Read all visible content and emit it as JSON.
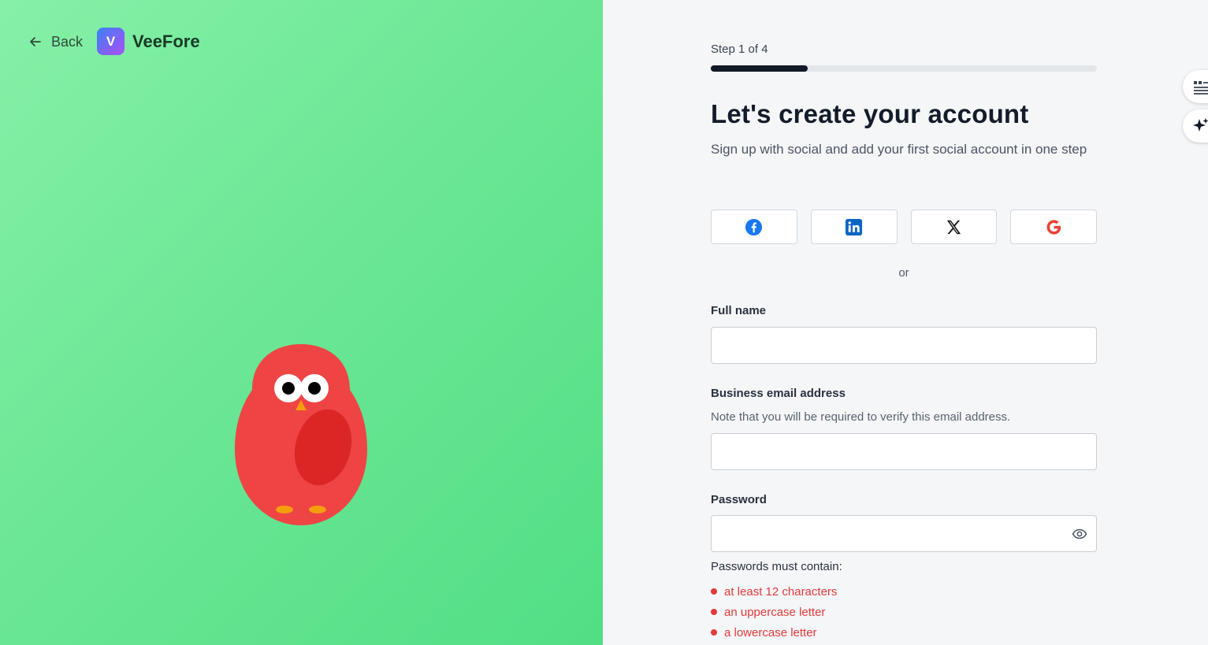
{
  "header": {
    "back_label": "Back",
    "brand_initial": "V",
    "brand_name": "VeeFore"
  },
  "form": {
    "step_text": "Step 1 of 4",
    "progress": 0.25,
    "title": "Let's create your account",
    "subtitle": "Sign up with social and add your first social account in one step",
    "social_buttons": [
      {
        "name": "facebook",
        "icon": "facebook-icon",
        "color": "#1877f2"
      },
      {
        "name": "linkedin",
        "icon": "linkedin-icon",
        "color": "#0a66c2"
      },
      {
        "name": "x",
        "icon": "x-icon",
        "color": "#111111"
      },
      {
        "name": "google",
        "icon": "google-icon",
        "color": "#ea4335"
      }
    ],
    "or_label": "or",
    "full_name": {
      "label": "Full name",
      "value": "",
      "placeholder": ""
    },
    "email": {
      "label": "Business email address",
      "note": "Note that you will be required to verify this email address.",
      "value": "",
      "placeholder": ""
    },
    "password": {
      "label": "Password",
      "value": "",
      "requirements_title": "Passwords must contain:",
      "requirements": [
        "at least 12 characters",
        "an uppercase letter",
        "a lowercase letter"
      ]
    }
  },
  "floating": [
    {
      "icon": "quote-icon"
    },
    {
      "icon": "sparkle-icon"
    }
  ],
  "colors": {
    "left_panel": "#6ce795",
    "progress": "#111827",
    "requirement": "#e23a3a",
    "bird": "#ef4444"
  }
}
